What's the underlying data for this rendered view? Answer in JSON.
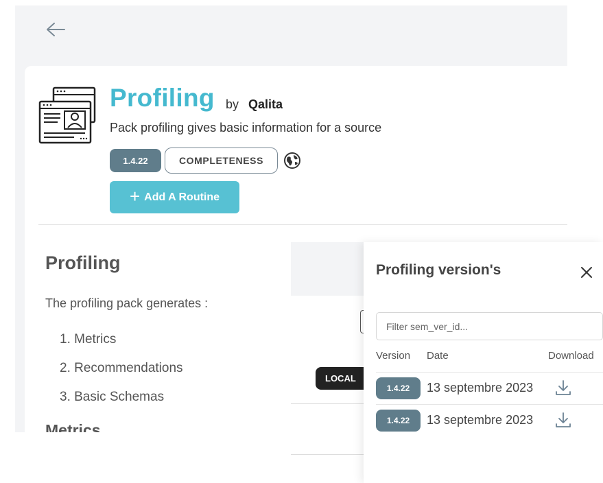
{
  "pack": {
    "title": "Profiling",
    "by": "by",
    "author": "Qalita",
    "description": "Pack profiling gives basic information for a source",
    "version": "1.4.22",
    "tag": "COMPLETENESS",
    "add_routine_label": "Add A Routine"
  },
  "readme": {
    "heading": "Profiling",
    "intro": "The profiling pack generates :",
    "items": [
      "1. Metrics",
      "2. Recommendations",
      "3. Basic Schemas"
    ],
    "next_heading": "Metrics"
  },
  "middle": {
    "local_badge": "LOCAL"
  },
  "drawer": {
    "title": "Profiling version's",
    "filter_placeholder": "Filter sem_ver_id...",
    "columns": {
      "version": "Version",
      "date": "Date",
      "download": "Download"
    },
    "rows": [
      {
        "version": "1.4.22",
        "date": "13 septembre 2023"
      },
      {
        "version": "1.4.22",
        "date": "13 septembre 2023"
      }
    ]
  },
  "colors": {
    "accent": "#45b9cf",
    "button": "#57c1d3",
    "badge": "#607d8b",
    "background": "#f3f4f6"
  }
}
